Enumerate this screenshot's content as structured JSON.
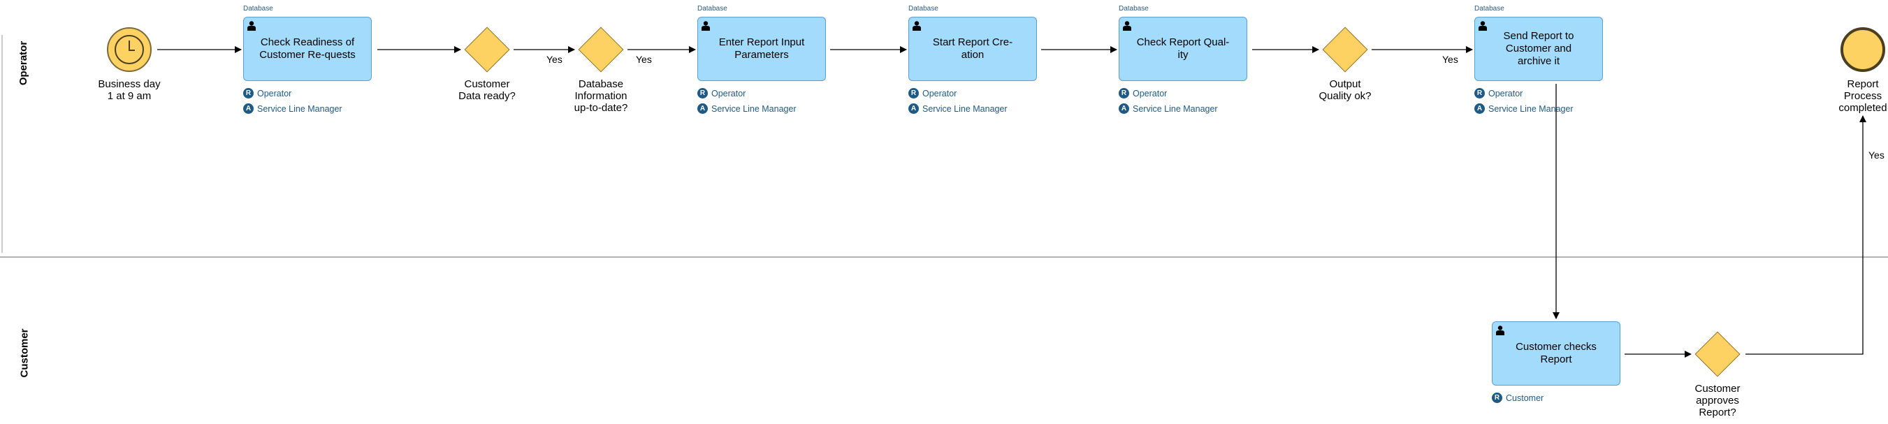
{
  "lanes": [
    {
      "label": "Operator"
    },
    {
      "label": "Customer"
    }
  ],
  "start_event": {
    "label": "Business day\n1 at 9 am",
    "icon": "clock-icon"
  },
  "end_event": {
    "label": "Report\nProcess\ncompleted"
  },
  "tasks": [
    {
      "label": "Check Readiness of Customer Re-quests",
      "tag": "Database",
      "roles": [
        {
          "badge": "R",
          "name": "Operator"
        },
        {
          "badge": "A",
          "name": "Service Line Manager"
        }
      ]
    },
    {
      "label": "Enter Report Input Parameters",
      "tag": "Database",
      "roles": [
        {
          "badge": "R",
          "name": "Operator"
        },
        {
          "badge": "A",
          "name": "Service Line Manager"
        }
      ]
    },
    {
      "label": "Start Report Cre-ation",
      "tag": "Database",
      "roles": [
        {
          "badge": "R",
          "name": "Operator"
        },
        {
          "badge": "A",
          "name": "Service Line Manager"
        }
      ]
    },
    {
      "label": "Check Report Qual-ity",
      "tag": "Database",
      "roles": [
        {
          "badge": "R",
          "name": "Operator"
        },
        {
          "badge": "A",
          "name": "Service Line Manager"
        }
      ]
    },
    {
      "label": "Send Report to Customer and archive it",
      "tag": "Database",
      "roles": [
        {
          "badge": "R",
          "name": "Operator"
        },
        {
          "badge": "A",
          "name": "Service Line Manager"
        }
      ]
    },
    {
      "label": "Customer checks Report",
      "roles": [
        {
          "badge": "R",
          "name": "Customer"
        }
      ]
    }
  ],
  "gateways": [
    {
      "label": "Customer\nData ready?"
    },
    {
      "label": "Database\nInformation\nup-to-date?"
    },
    {
      "label": "Output\nQuality ok?"
    },
    {
      "label": "Customer\napproves\nReport?"
    }
  ],
  "flow_labels": [
    "Yes",
    "Yes",
    "Yes",
    "Yes"
  ],
  "colors": {
    "task_fill": "#a2dbfc",
    "event_fill": "#fdd262",
    "role_badge": "#1f5a85"
  }
}
